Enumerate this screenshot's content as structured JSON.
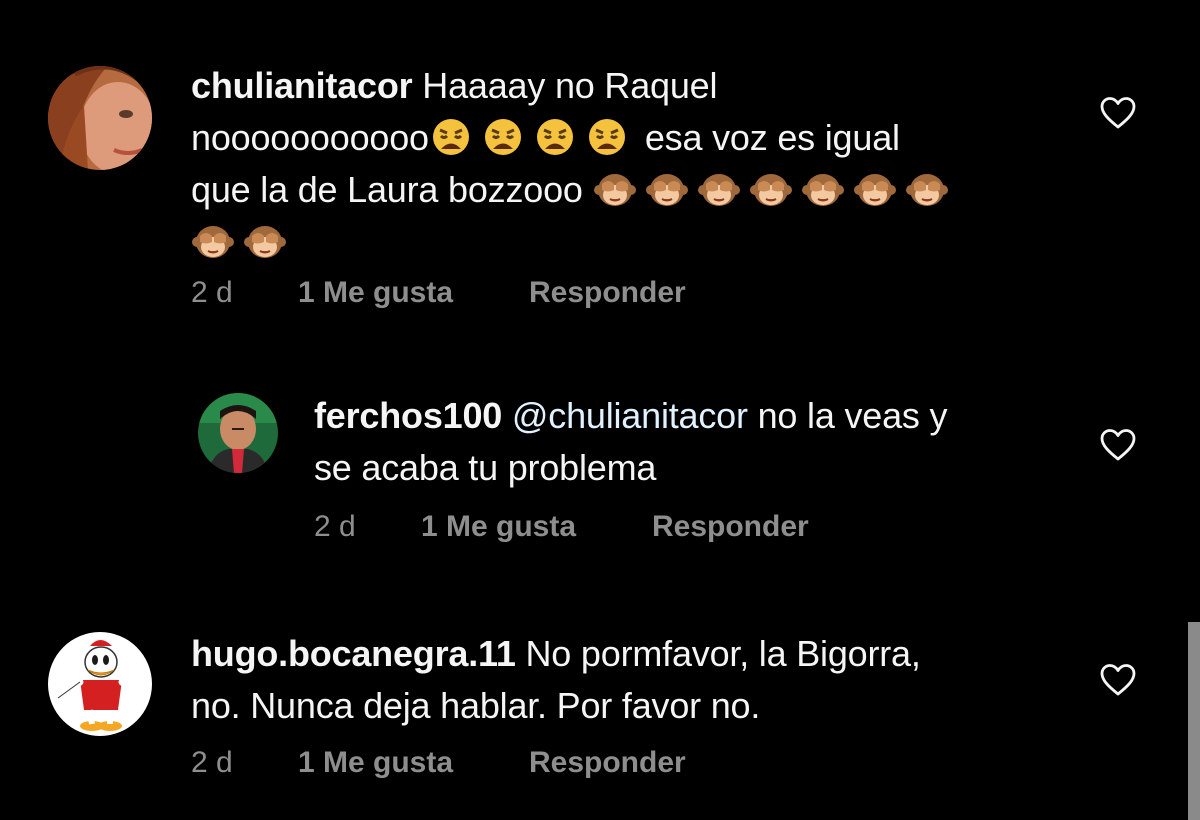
{
  "comments": [
    {
      "username": "chulianitacor",
      "text_1": "Haaaay no Raquel",
      "text_2": "nooooooooooo",
      "text_3": "esa voz es igual",
      "text_4": "que la de Laura bozzooo",
      "time": "2 d",
      "likes": "1 Me gusta",
      "reply": "Responder",
      "emoji_weary_count": 4,
      "emoji_monkey_count": 9
    },
    {
      "username": "ferchos100",
      "mention": "@chulianitacor",
      "text_1": "no la veas y",
      "text_2": "se acaba tu problema",
      "time": "2 d",
      "likes": "1 Me gusta",
      "reply": "Responder"
    },
    {
      "username": "hugo.bocanegra.11",
      "text_1": "No pormfavor, la Bigorra,",
      "text_2": "no. Nunca deja hablar. Por favor no.",
      "time": "2 d",
      "likes": "1 Me gusta",
      "reply": "Responder"
    }
  ],
  "icons": {
    "like": "heart-outline-icon",
    "emoji_weary": "weary-face-emoji",
    "emoji_monkey": "see-no-evil-monkey-emoji"
  },
  "colors": {
    "background": "#000000",
    "text": "#f5f5f5",
    "meta": "#8e8e8e",
    "mention": "#e0f1ff",
    "scrollbar": "#8a8a8a"
  }
}
